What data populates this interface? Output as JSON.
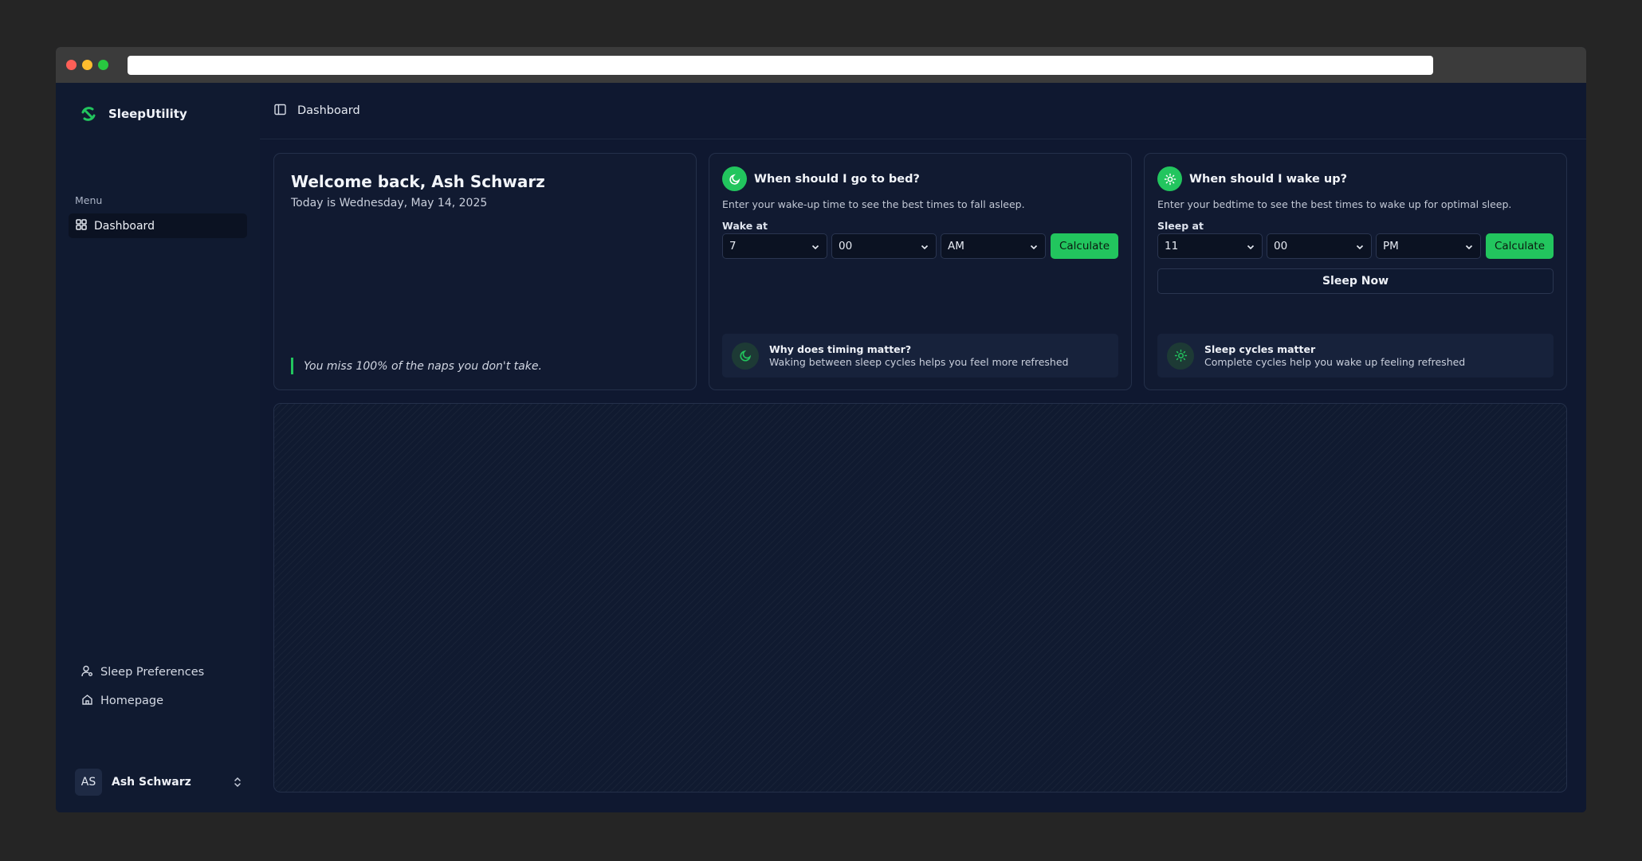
{
  "app": {
    "name": "SleepUtility"
  },
  "sidebar": {
    "menu_label": "Menu",
    "items": [
      {
        "label": "Dashboard",
        "icon": "grid-icon",
        "active": true
      }
    ],
    "footer_links": [
      {
        "label": "Sleep Preferences",
        "icon": "user-cog-icon"
      },
      {
        "label": "Homepage",
        "icon": "home-icon"
      }
    ],
    "user": {
      "initials": "AS",
      "name": "Ash Schwarz"
    }
  },
  "header": {
    "title": "Dashboard"
  },
  "welcome": {
    "title": "Welcome back, Ash Schwarz",
    "date": "Today is Wednesday, May 14, 2025",
    "quote": "You miss 100% of the naps you don't take."
  },
  "bedtime_card": {
    "title": "When should I go to bed?",
    "description": "Enter your wake-up time to see the best times to fall asleep.",
    "field_label": "Wake at",
    "hour": "7",
    "minute": "00",
    "period": "AM",
    "calculate_label": "Calculate",
    "tip": {
      "title": "Why does timing matter?",
      "text": "Waking between sleep cycles helps you feel more refreshed"
    }
  },
  "wakeup_card": {
    "title": "When should I wake up?",
    "description": "Enter your bedtime to see the best times to wake up for optimal sleep.",
    "field_label": "Sleep at",
    "hour": "11",
    "minute": "00",
    "period": "PM",
    "calculate_label": "Calculate",
    "sleep_now_label": "Sleep Now",
    "tip": {
      "title": "Sleep cycles matter",
      "text": "Complete cycles help you wake up feeling refreshed"
    }
  },
  "colors": {
    "accent": "#22c55e",
    "background": "#0f1830",
    "sidebar": "#101a30",
    "card": "#111a31"
  }
}
